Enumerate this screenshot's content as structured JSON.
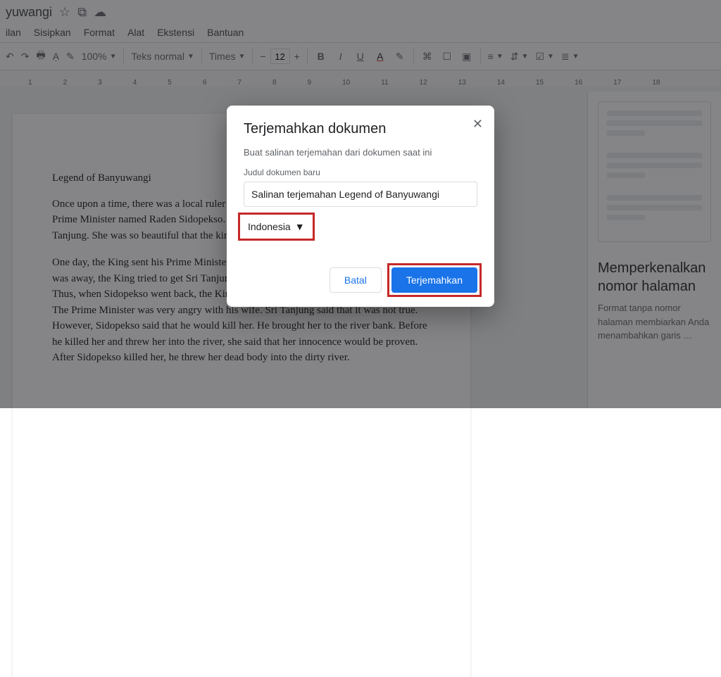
{
  "header": {
    "doc_title": "yuwangi"
  },
  "menu": {
    "items": [
      "ilan",
      "Sisipkan",
      "Format",
      "Alat",
      "Ekstensi",
      "Bantuan"
    ]
  },
  "toolbar": {
    "zoom": "100%",
    "style_label": "Teks normal",
    "font_label": "Times",
    "font_size": "12"
  },
  "ruler": {
    "marks": [
      "1",
      "2",
      "3",
      "4",
      "5",
      "6",
      "7",
      "8",
      "9",
      "10",
      "11",
      "12",
      "13",
      "14",
      "15",
      "16",
      "17",
      "18"
    ]
  },
  "document": {
    "title": "Legend of Banyuwangi",
    "para1": "Once upon a time, there was a local ruler named King Sulahkromo. The King had a Prime Minister named Raden Sidopekso. The Prime Minister had a wife named Sri Tanjung. She was so beautiful that the king wanted her to be his wife.",
    "para2": "One day, the King sent his Prime Minister to a long mission. While the Prime Minister was away, the King tried to get Sri Tanjung. However he failed. He was very angry. Thus, when Sidopekso went back, the King told him that his wife was unfaithful to him. The Prime Minister was very angry with his wife. Sri Tanjung said that it was not true. However, Sidopekso said that he would kill her. He brought her to the river bank. Before he killed her and threw her into the river, she said that her innocence would be proven. After Sidopekso killed her, he threw her dead body into the dirty river."
  },
  "rightpanel": {
    "heading": "Memperkenalkan nomor halaman",
    "body": "Format tanpa nomor halaman membiarkan Anda menambahkan garis …"
  },
  "dialog": {
    "title": "Terjemahkan dokumen",
    "subtitle": "Buat salinan terjemahan dari dokumen saat ini",
    "field_label": "Judul dokumen baru",
    "field_value": "Salinan terjemahan Legend of Banyuwangi",
    "language": "Indonesia",
    "cancel_label": "Batal",
    "confirm_label": "Terjemahkan"
  },
  "colors": {
    "highlight": "#c62828"
  }
}
